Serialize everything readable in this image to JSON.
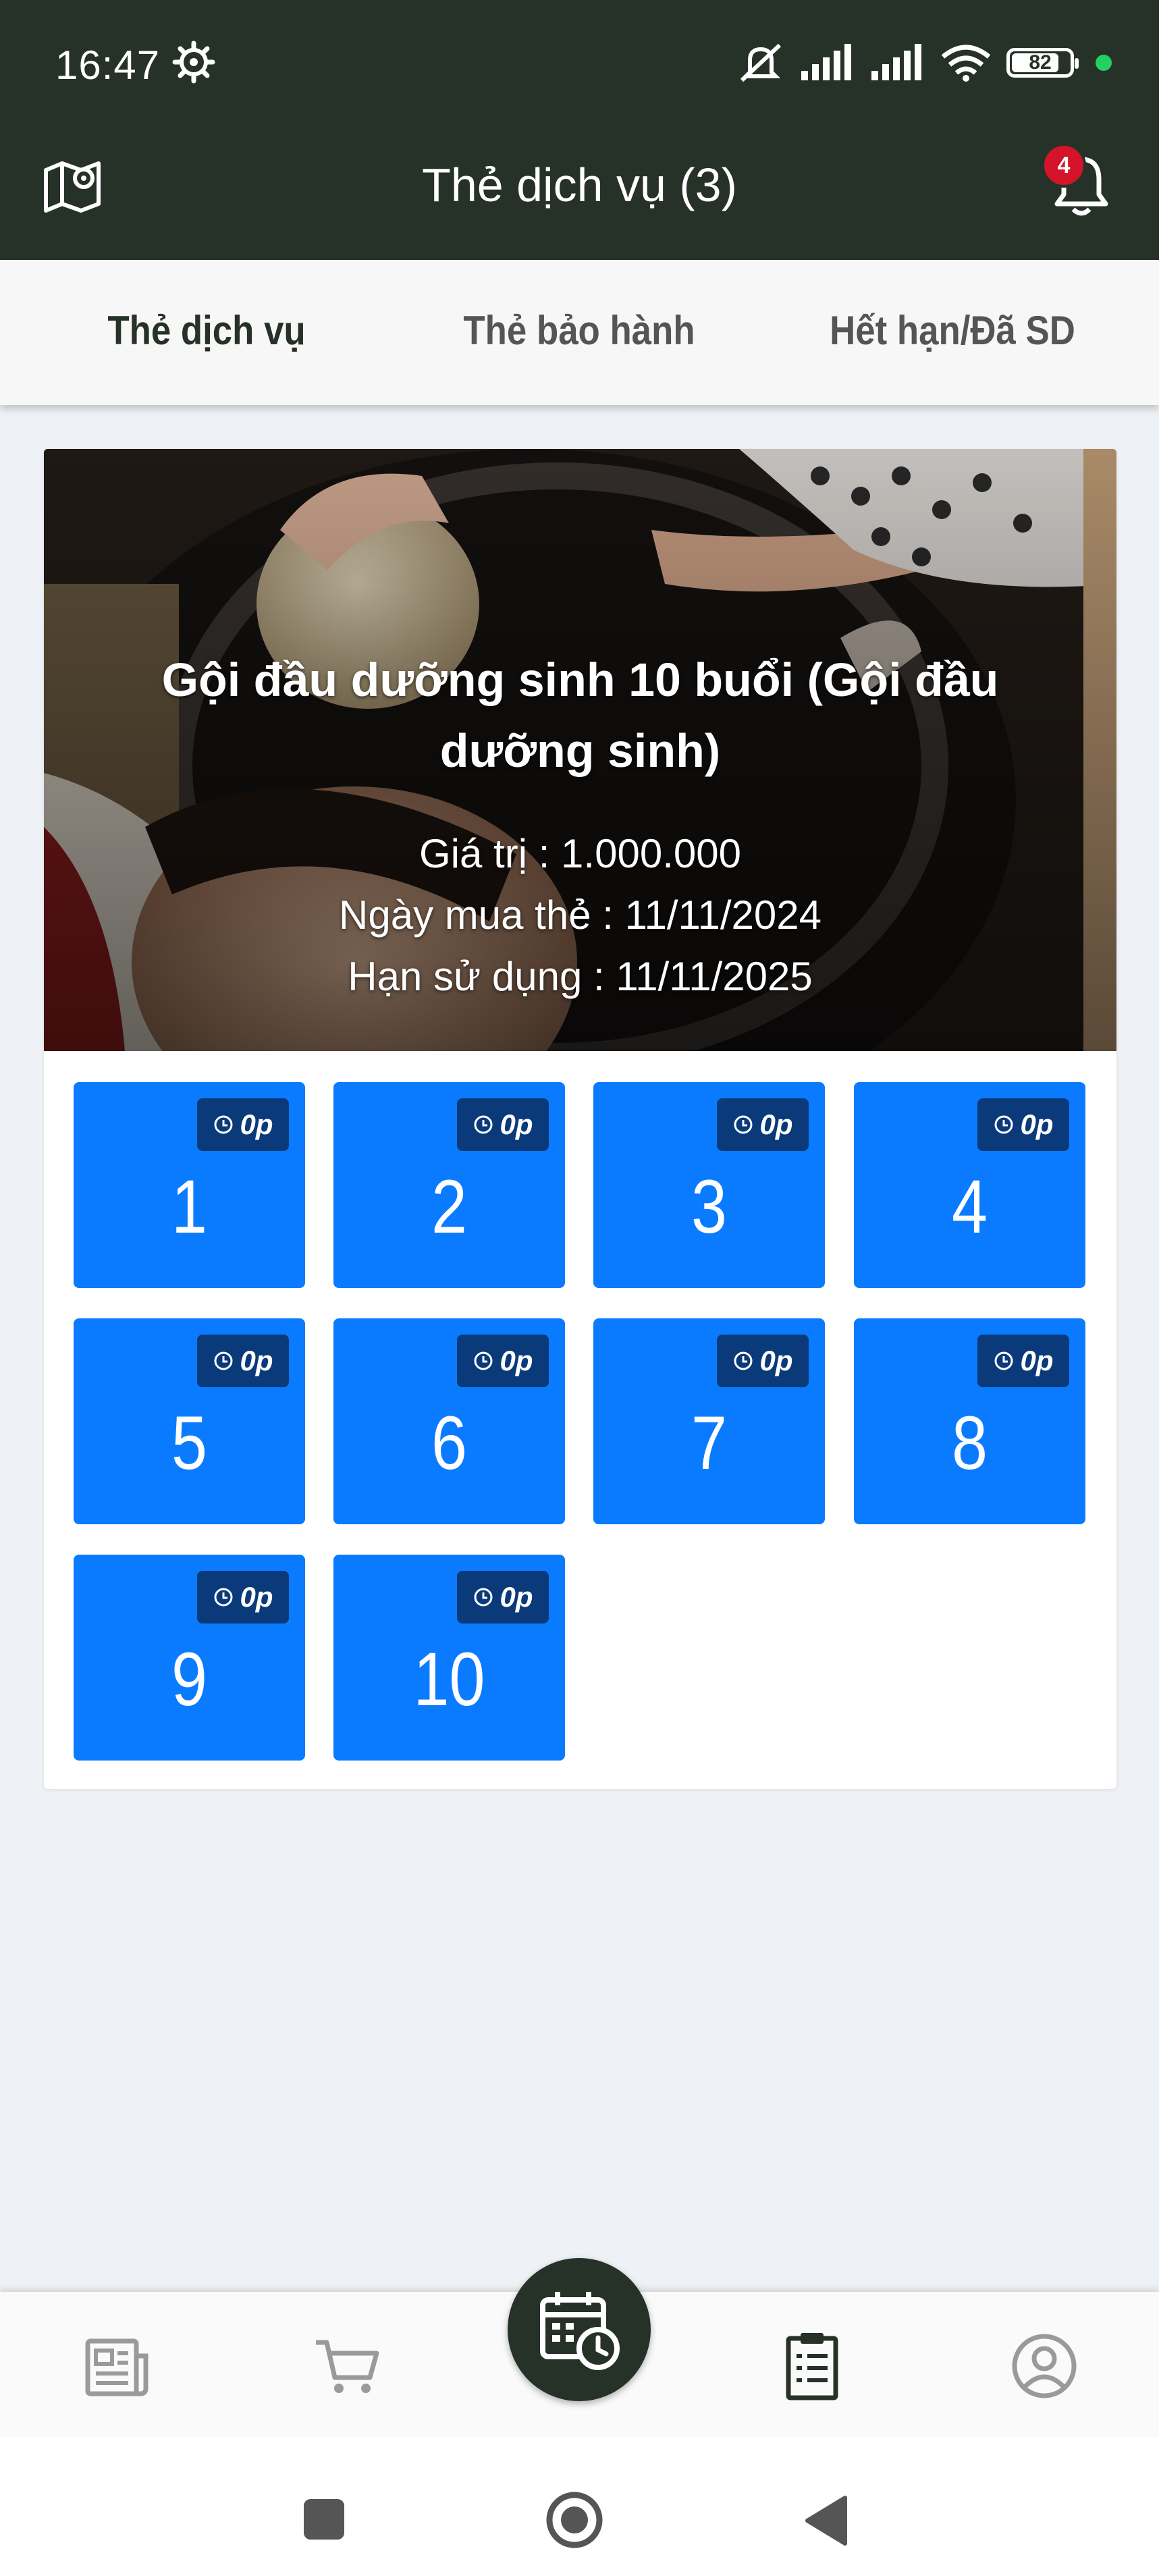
{
  "status_bar": {
    "time": "16:47",
    "battery": "82",
    "battery_level": 0.82
  },
  "header": {
    "title": "Thẻ dịch vụ (3)",
    "notification_count": "4"
  },
  "tabs": [
    {
      "label": "Thẻ dịch vụ",
      "active": true
    },
    {
      "label": "Thẻ bảo hành",
      "active": false
    },
    {
      "label": "Hết hạn/Đã SD",
      "active": false
    }
  ],
  "card": {
    "name": "Gội đầu dưỡng sinh 10 buổi (Gội đầu dưỡng sinh)",
    "value_line": "Giá trị : 1.000.000",
    "purchase_line": "Ngày mua thẻ : 11/11/2024",
    "expiry_line": "Hạn sử dụng : 11/11/2025",
    "sessions": [
      {
        "number": "1",
        "duration": "0p"
      },
      {
        "number": "2",
        "duration": "0p"
      },
      {
        "number": "3",
        "duration": "0p"
      },
      {
        "number": "4",
        "duration": "0p"
      },
      {
        "number": "5",
        "duration": "0p"
      },
      {
        "number": "6",
        "duration": "0p"
      },
      {
        "number": "7",
        "duration": "0p"
      },
      {
        "number": "8",
        "duration": "0p"
      },
      {
        "number": "9",
        "duration": "0p"
      },
      {
        "number": "10",
        "duration": "0p"
      }
    ]
  },
  "bottom_nav": [
    {
      "icon": "newspaper-icon"
    },
    {
      "icon": "cart-icon"
    },
    {
      "icon": "calendar-clock-icon"
    },
    {
      "icon": "clipboard-list-icon"
    },
    {
      "icon": "user-circle-icon"
    }
  ],
  "colors": {
    "header_bg": "#263128",
    "session_bg": "#0a7bff",
    "duration_bg": "#0b3a7a",
    "badge": "#d4142a"
  }
}
